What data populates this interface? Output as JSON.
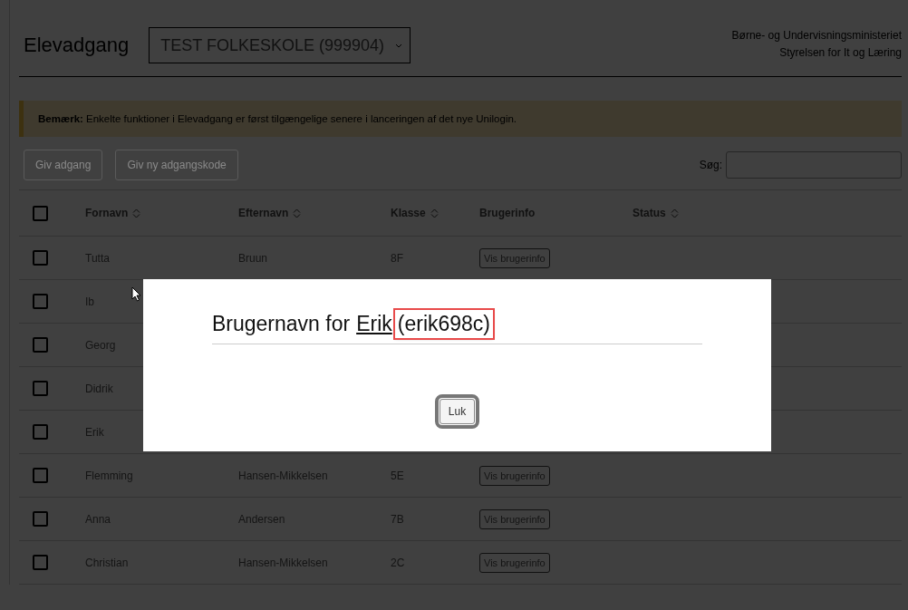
{
  "header": {
    "title": "Elevadgang",
    "school_select": "TEST FOLKESKOLE (999904)",
    "org_lines": [
      "Børne- og Undervisningsministeriet",
      "Styrelsen for It og Læring"
    ]
  },
  "notice": {
    "text": "**Bemærk:** Enkelte funktioner i Elevadgang er først tilgængelige senere i lanceringen af det nye Unilogin."
  },
  "toolbar": {
    "buttons": [
      {
        "label": "Giv adgang",
        "disabled": true
      },
      {
        "label": "Giv ny adgangskode",
        "disabled": true
      }
    ],
    "search_label": "Søg:"
  },
  "table": {
    "columns": [
      {
        "label": "Fornavn",
        "sortable": true
      },
      {
        "label": "Efternavn",
        "sortable": true
      },
      {
        "label": "Klasse",
        "sortable": true
      },
      {
        "label": "Brugerinfo",
        "sortable": false
      },
      {
        "label": "Status",
        "sortable": true
      }
    ],
    "header_checked": false,
    "rows": [
      {
        "checked": false,
        "first_name": "Tutta",
        "last_name": "Bruun",
        "class": "8F",
        "info_button": "Vis brugerinfo"
      },
      {
        "checked": false,
        "first_name": "Ib"
      },
      {
        "checked": false,
        "first_name": "Georg"
      },
      {
        "checked": false,
        "first_name": "Didrik"
      },
      {
        "checked": false,
        "first_name": "Erik"
      },
      {
        "checked": false,
        "first_name": "Flemming",
        "last_name": "Hansen-Mikkelsen",
        "class": "5E",
        "info_button": "Vis brugerinfo"
      },
      {
        "checked": false,
        "first_name": "Anna",
        "last_name": "Andersen",
        "class": "7B",
        "info_button": "Vis brugerinfo"
      },
      {
        "checked": false,
        "first_name": "Christian",
        "last_name": "Hansen-Mikkelsen",
        "class": "2C",
        "info_button": "Vis brugerinfo"
      }
    ]
  },
  "modal": {
    "title_prefix": "Brugernavn for",
    "name_link": "Erik",
    "username": "(erik698c)",
    "username_highlighted": true,
    "close_button": "Luk",
    "close_focused": true
  }
}
